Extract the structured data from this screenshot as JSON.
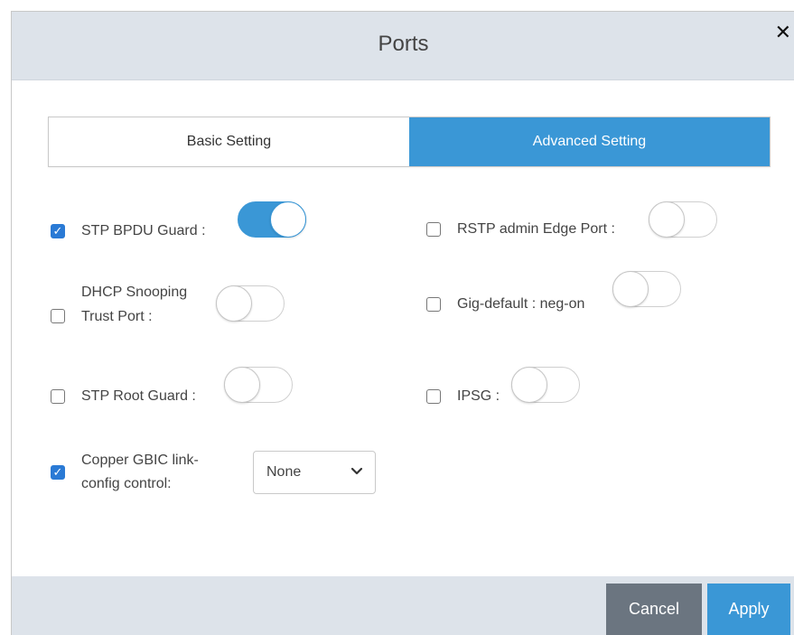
{
  "dialog": {
    "title": "Ports"
  },
  "tabs": [
    {
      "label": "Basic Setting",
      "active": false
    },
    {
      "label": "Advanced Setting",
      "active": true
    }
  ],
  "options": {
    "stp_bpdu_guard": {
      "label": "STP BPDU Guard :",
      "checked": true,
      "toggle_on": true
    },
    "rstp_admin_edge_port": {
      "label": "RSTP admin Edge Port :",
      "checked": false,
      "toggle_on": false
    },
    "dhcp_snooping_trust_port": {
      "label_line1": "DHCP Snooping",
      "label_line2": "Trust Port :",
      "checked": false,
      "toggle_on": false
    },
    "gig_default_neg_on": {
      "label": "Gig-default : neg-on",
      "checked": false,
      "toggle_on": false
    },
    "stp_root_guard": {
      "label": "STP Root Guard :",
      "checked": false,
      "toggle_on": false
    },
    "ipsg": {
      "label": "IPSG :",
      "checked": false,
      "toggle_on": false
    },
    "copper_gbic": {
      "label_line1": "Copper GBIC link-",
      "label_line2": "config control:",
      "checked": true,
      "selected": "None"
    }
  },
  "footer": {
    "cancel_label": "Cancel",
    "apply_label": "Apply"
  },
  "colors": {
    "accent": "#3a97d6",
    "cancel": "#6b7580",
    "header_bg": "#dde3ea"
  }
}
